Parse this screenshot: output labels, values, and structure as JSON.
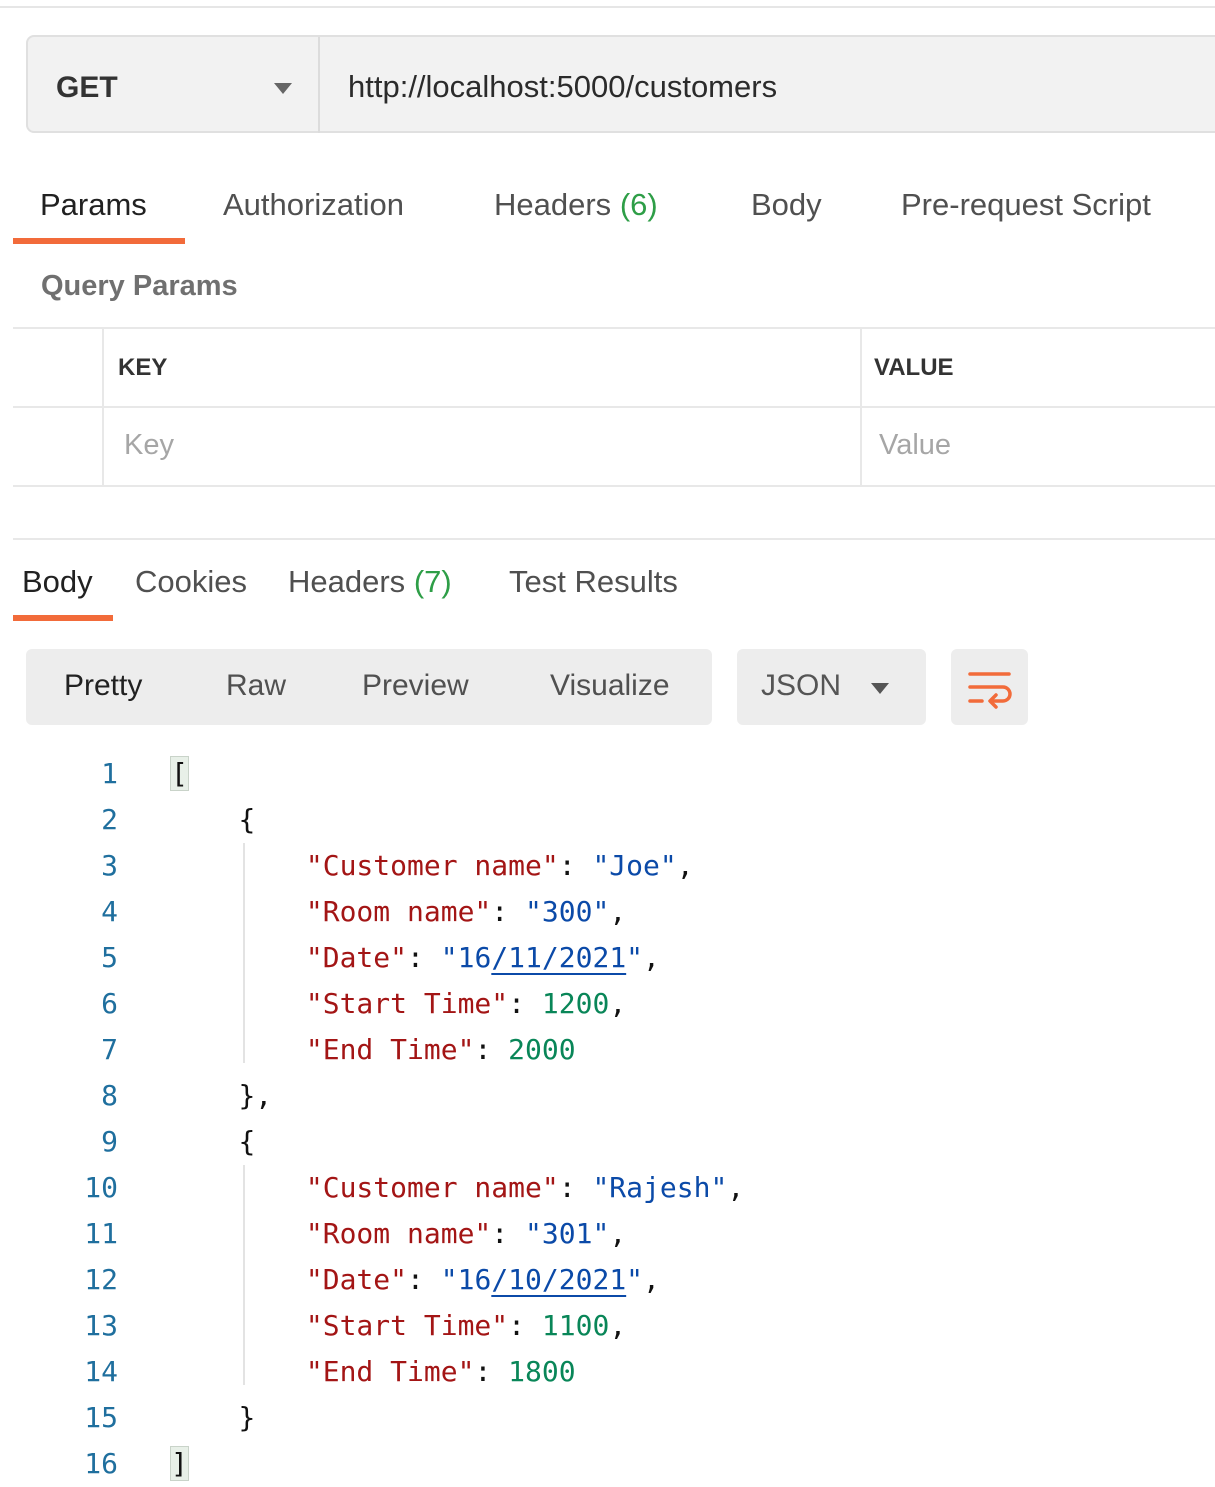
{
  "request": {
    "method": "GET",
    "url": "http://localhost:5000/customers"
  },
  "request_tabs": [
    {
      "label": "Params"
    },
    {
      "label": "Authorization"
    },
    {
      "label": "Headers",
      "count": "(6)"
    },
    {
      "label": "Body"
    },
    {
      "label": "Pre-request Script"
    }
  ],
  "query_params": {
    "title": "Query Params",
    "key_header": "KEY",
    "value_header": "VALUE",
    "key_placeholder": "Key",
    "value_placeholder": "Value"
  },
  "response_tabs": [
    {
      "label": "Body"
    },
    {
      "label": "Cookies"
    },
    {
      "label": "Headers",
      "count": "(7)"
    },
    {
      "label": "Test Results"
    }
  ],
  "view_modes": [
    "Pretty",
    "Raw",
    "Preview",
    "Visualize"
  ],
  "format": "JSON",
  "colors": {
    "accent": "#f26b3a",
    "count": "#2e9e47",
    "key": "#a31515",
    "string": "#0b4aa8",
    "number": "#098658"
  },
  "code_lines": [
    {
      "n": "1",
      "pre": "",
      "open": "["
    },
    {
      "n": "2",
      "pre": "    ",
      "open": "{"
    },
    {
      "n": "3",
      "pre": "        ",
      "key": "\"Customer name\"",
      "sep": ": ",
      "str": "\"Joe\"",
      "post": ","
    },
    {
      "n": "4",
      "pre": "        ",
      "key": "\"Room name\"",
      "sep": ": ",
      "str": "\"300\"",
      "post": ","
    },
    {
      "n": "5",
      "pre": "        ",
      "key": "\"Date\"",
      "sep": ": ",
      "str": "\"16/11/2021\"",
      "post": ","
    },
    {
      "n": "6",
      "pre": "        ",
      "key": "\"Start Time\"",
      "sep": ": ",
      "num": "1200",
      "post": ","
    },
    {
      "n": "7",
      "pre": "        ",
      "key": "\"End Time\"",
      "sep": ": ",
      "num": "2000",
      "post": ""
    },
    {
      "n": "8",
      "pre": "    ",
      "open": "},"
    },
    {
      "n": "9",
      "pre": "    ",
      "open": "{"
    },
    {
      "n": "10",
      "pre": "        ",
      "key": "\"Customer name\"",
      "sep": ": ",
      "str": "\"Rajesh\"",
      "post": ","
    },
    {
      "n": "11",
      "pre": "        ",
      "key": "\"Room name\"",
      "sep": ": ",
      "str": "\"301\"",
      "post": ","
    },
    {
      "n": "12",
      "pre": "        ",
      "key": "\"Date\"",
      "sep": ": ",
      "str": "\"16/10/2021\"",
      "post": ","
    },
    {
      "n": "13",
      "pre": "        ",
      "key": "\"Start Time\"",
      "sep": ": ",
      "num": "1100",
      "post": ","
    },
    {
      "n": "14",
      "pre": "        ",
      "key": "\"End Time\"",
      "sep": ": ",
      "num": "1800",
      "post": ""
    },
    {
      "n": "15",
      "pre": "    ",
      "open": "}"
    },
    {
      "n": "16",
      "pre": "",
      "open": "]"
    }
  ]
}
